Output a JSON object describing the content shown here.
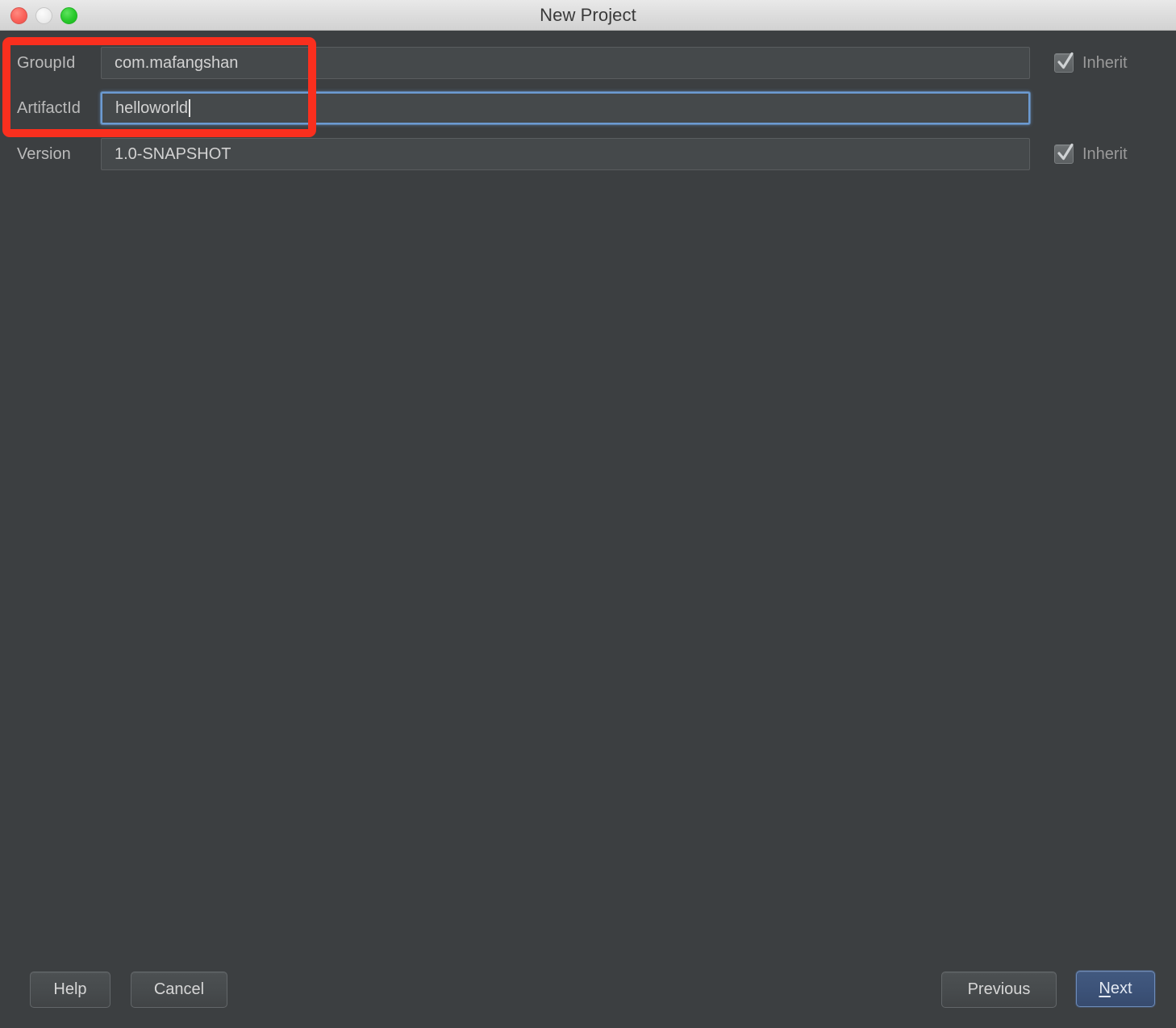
{
  "window": {
    "title": "New Project",
    "traffic_lights": [
      {
        "name": "close",
        "color": "#fa6159"
      },
      {
        "name": "minimize",
        "color": "#ededed"
      },
      {
        "name": "maximize",
        "color": "#28c92b"
      }
    ]
  },
  "form": {
    "rows": [
      {
        "label": "GroupId",
        "value": "com.mafangshan",
        "focused": false,
        "has_inherit": true,
        "inherit_label": "Inherit",
        "inherit_checked": true
      },
      {
        "label": "ArtifactId",
        "value": "helloworld",
        "focused": true,
        "has_inherit": false,
        "inherit_label": "",
        "inherit_checked": false
      },
      {
        "label": "Version",
        "value": "1.0-SNAPSHOT",
        "focused": false,
        "has_inherit": true,
        "inherit_label": "Inherit",
        "inherit_checked": true
      }
    ]
  },
  "annotation": {
    "color": "#fa2f1e",
    "shape": "rounded-rectangle"
  },
  "footer": {
    "help_label": "Help",
    "cancel_label": "Cancel",
    "previous_label": "Previous",
    "next_label": "Next",
    "next_mnemonic": "N",
    "next_rest": "ext",
    "next_accent": "#3c5278"
  },
  "colors": {
    "dialog_background": "#3c3f41",
    "field_background": "#45494b",
    "titlebar_background": "#dcdcdc",
    "focus_border": "#6c9bd2",
    "text": "#d2d2d2",
    "label_text": "#bbbbbb"
  }
}
